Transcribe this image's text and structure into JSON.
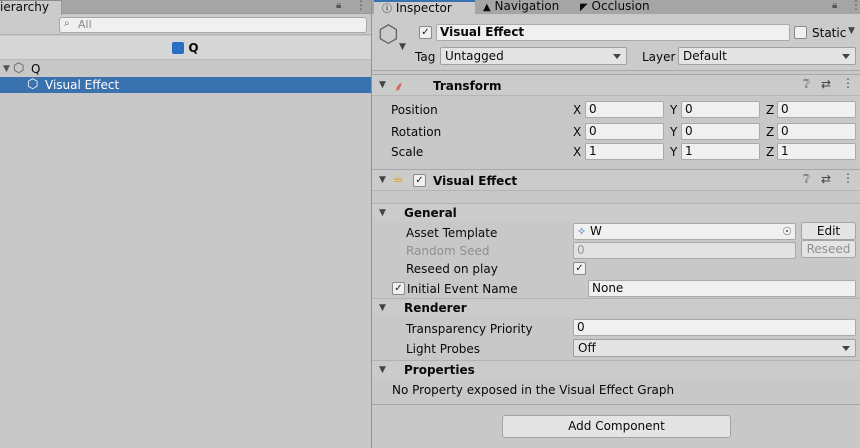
{
  "hierarchy": {
    "tab_label": "ierarchy",
    "search_placeholder": "All",
    "scene_name": "Q",
    "items": [
      {
        "label": "Q"
      },
      {
        "label": "Visual Effect"
      }
    ]
  },
  "inspector": {
    "tabs": [
      {
        "label": "Inspector"
      },
      {
        "label": "Navigation"
      },
      {
        "label": "Occlusion"
      }
    ],
    "object": {
      "active": true,
      "name": "Visual Effect",
      "static_label": "Static",
      "tag_label": "Tag",
      "tag_value": "Untagged",
      "layer_label": "Layer",
      "layer_value": "Default"
    },
    "transform": {
      "title": "Transform",
      "position_label": "Position",
      "rotation_label": "Rotation",
      "scale_label": "Scale",
      "axis_x": "X",
      "axis_y": "Y",
      "axis_z": "Z",
      "position": [
        "0",
        "0",
        "0"
      ],
      "rotation": [
        "0",
        "0",
        "0"
      ],
      "scale": [
        "1",
        "1",
        "1"
      ]
    },
    "visual_effect": {
      "title": "Visual Effect",
      "general_label": "General",
      "asset_template_label": "Asset Template",
      "asset_template_value": "W",
      "edit_label": "Edit",
      "random_seed_label": "Random Seed",
      "random_seed_value": "0",
      "reseed_label": "Reseed",
      "reseed_on_play_label": "Reseed on play",
      "initial_event_label": "Initial Event Name",
      "initial_event_value": "None",
      "renderer_label": "Renderer",
      "transparency_label": "Transparency Priority",
      "transparency_value": "0",
      "light_probes_label": "Light Probes",
      "light_probes_value": "Off",
      "properties_label": "Properties",
      "no_property_text": "No Property exposed in the Visual Effect Graph"
    },
    "add_component_label": "Add Component"
  },
  "colors": {
    "selection": "#3a72b0",
    "panel_bg": "#c8c8c8",
    "header_bg": "#cbcbcb",
    "field_bg": "#f0f0f0"
  }
}
